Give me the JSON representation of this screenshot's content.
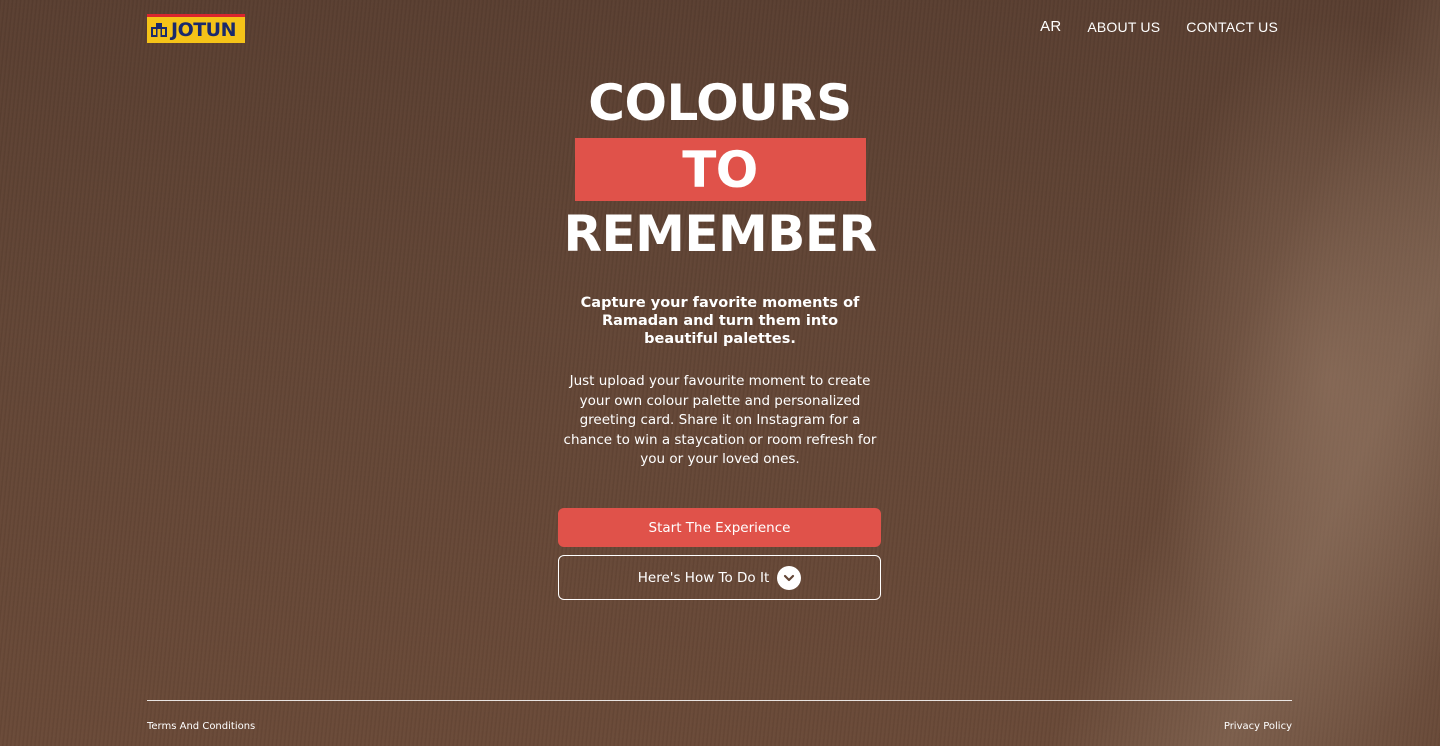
{
  "brand": {
    "logo_text": "JOTUN",
    "colors": {
      "yellow": "#f5c318",
      "red": "#d9262e",
      "navy": "#1a2a6c"
    }
  },
  "nav": {
    "language": "AR",
    "about": "ABOUT US",
    "contact": "CONTACT US"
  },
  "hero": {
    "title_line1": "COLOURS",
    "title_line2": "TO",
    "title_line3": "REMEMBER",
    "subheading": "Capture your favorite moments of Ramadan and turn them into beautiful palettes.",
    "body": "Just upload your favourite moment to create your own colour palette and personalized greeting card. Share it on Instagram for a chance to win a staycation or room refresh for you or your loved ones."
  },
  "actions": {
    "start": "Start The Experience",
    "how_to": "Here's How To Do It",
    "how_to_icon": "chevron-down-icon"
  },
  "footer": {
    "terms": "Terms And Conditions",
    "privacy": "Privacy Policy"
  },
  "theme": {
    "accent": "#e0524a",
    "background": "#634636",
    "text": "#ffffff"
  }
}
